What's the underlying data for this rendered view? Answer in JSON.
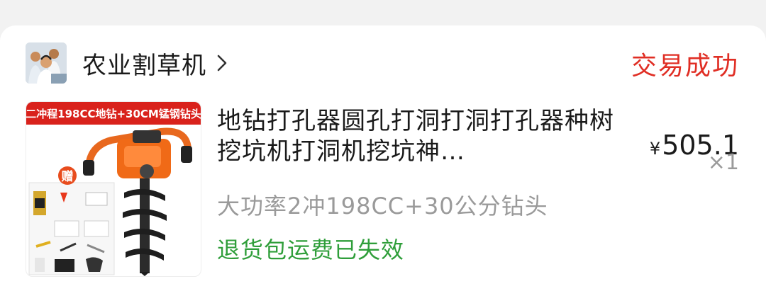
{
  "order": {
    "store_name": "农业割草机",
    "status": "交易成功",
    "product": {
      "thumbnail_banner": "二冲程198CC地钻+30CM锰钢钻头",
      "thumbnail_badge": "赠",
      "title": "地钻打孔器圆孔打洞打洞打孔器种树挖坑机打洞机挖坑神…",
      "spec": "大功率2冲198CC+30公分钻头",
      "price_symbol": "¥",
      "price": "505.1",
      "quantity": "×1",
      "notice": "退货包运费已失效"
    }
  },
  "colors": {
    "status_red": "#e02e24",
    "notice_green": "#2f9e3a",
    "muted_gray": "#9a9a9a"
  },
  "icons": {
    "store_avatar": "customer-service-avatar-icon",
    "store_chevron": "chevron-right-icon"
  }
}
